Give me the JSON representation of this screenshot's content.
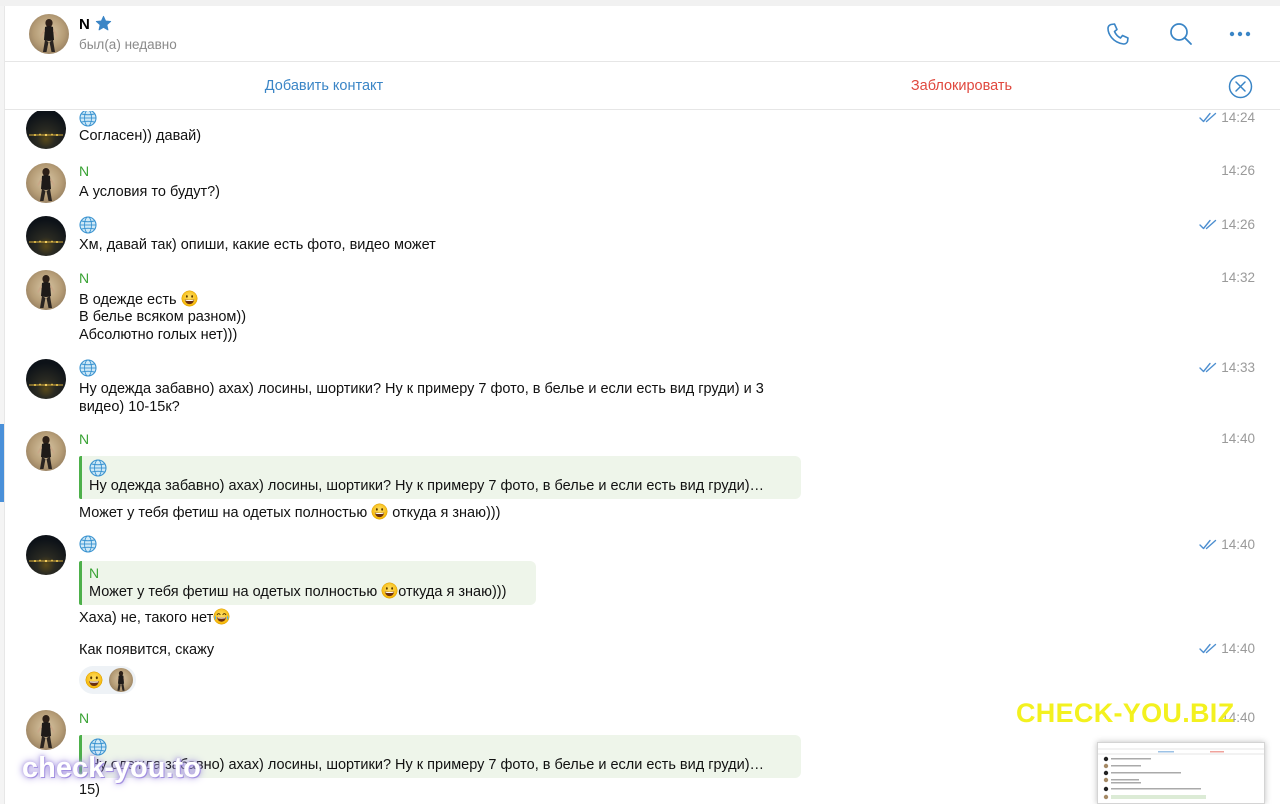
{
  "header": {
    "peer_name": "N",
    "peer_status": "был(а) недавно",
    "icons": [
      "phone-icon",
      "search-icon",
      "more-icon"
    ]
  },
  "actionbar": {
    "add_contact": "Добавить контакт",
    "block": "Заблокировать"
  },
  "messages": [
    {
      "sender": "",
      "text": "Согласен)) давай)",
      "time": "14:24",
      "read": true
    },
    {
      "sender": "N",
      "text": "А условия то будут?)",
      "time": "14:26",
      "read": false
    },
    {
      "sender": "",
      "text": "Хм, давай так) опиши, какие есть фото, видео может",
      "time": "14:26",
      "read": true
    },
    {
      "sender": "N",
      "line1": "В одежде есть",
      "line2": "В белье всяком разном))",
      "line3": "Абсолютно голых нет)))",
      "time": "14:32",
      "read": false
    },
    {
      "sender": "",
      "line1": "Ну одежда забавно) ахах) лосины, шортики? Ну к примеру 7 фото, в белье и если есть вид груди) и 3",
      "line2": "видео) 10-15к?",
      "time": "14:33",
      "read": true
    },
    {
      "sender": "N",
      "quote_text": "Ну одежда забавно) ахах) лосины, шортики? Ну к примеру 7 фото, в белье и если есть вид груди)…",
      "text_before": "Может у тебя фетиш на одетых полностью ",
      "text_after": " откуда я знаю)))",
      "time": "14:40",
      "read": false
    },
    {
      "sender": "",
      "quote_sender": "N",
      "quote_before": "Может у тебя фетиш на одетых полностью ",
      "quote_after": "откуда я знаю)))",
      "text": "Хаха) не, такого нет",
      "time": "",
      "read": false
    },
    {
      "sender": "",
      "text": "Как появится, скажу",
      "time": "14:40",
      "read": true
    },
    {
      "sender": "N",
      "quote_text": "Ну одежда забавно) ахах) лосины, шортики? Ну к примеру 7 фото, в белье и если есть вид груди)…",
      "text": "15)",
      "time": "14:40",
      "read": false
    }
  ],
  "msg7_time": "14:40",
  "watermarks": {
    "yellow": "CHECK-YOU.BIZ",
    "white": "check-you.to"
  },
  "colors": {
    "link_blue": "#3a85c6",
    "block_red": "#e0483e",
    "sender_green": "#3aa335",
    "quote_bg": "#eef5ea",
    "quote_bar": "#4db04a"
  }
}
